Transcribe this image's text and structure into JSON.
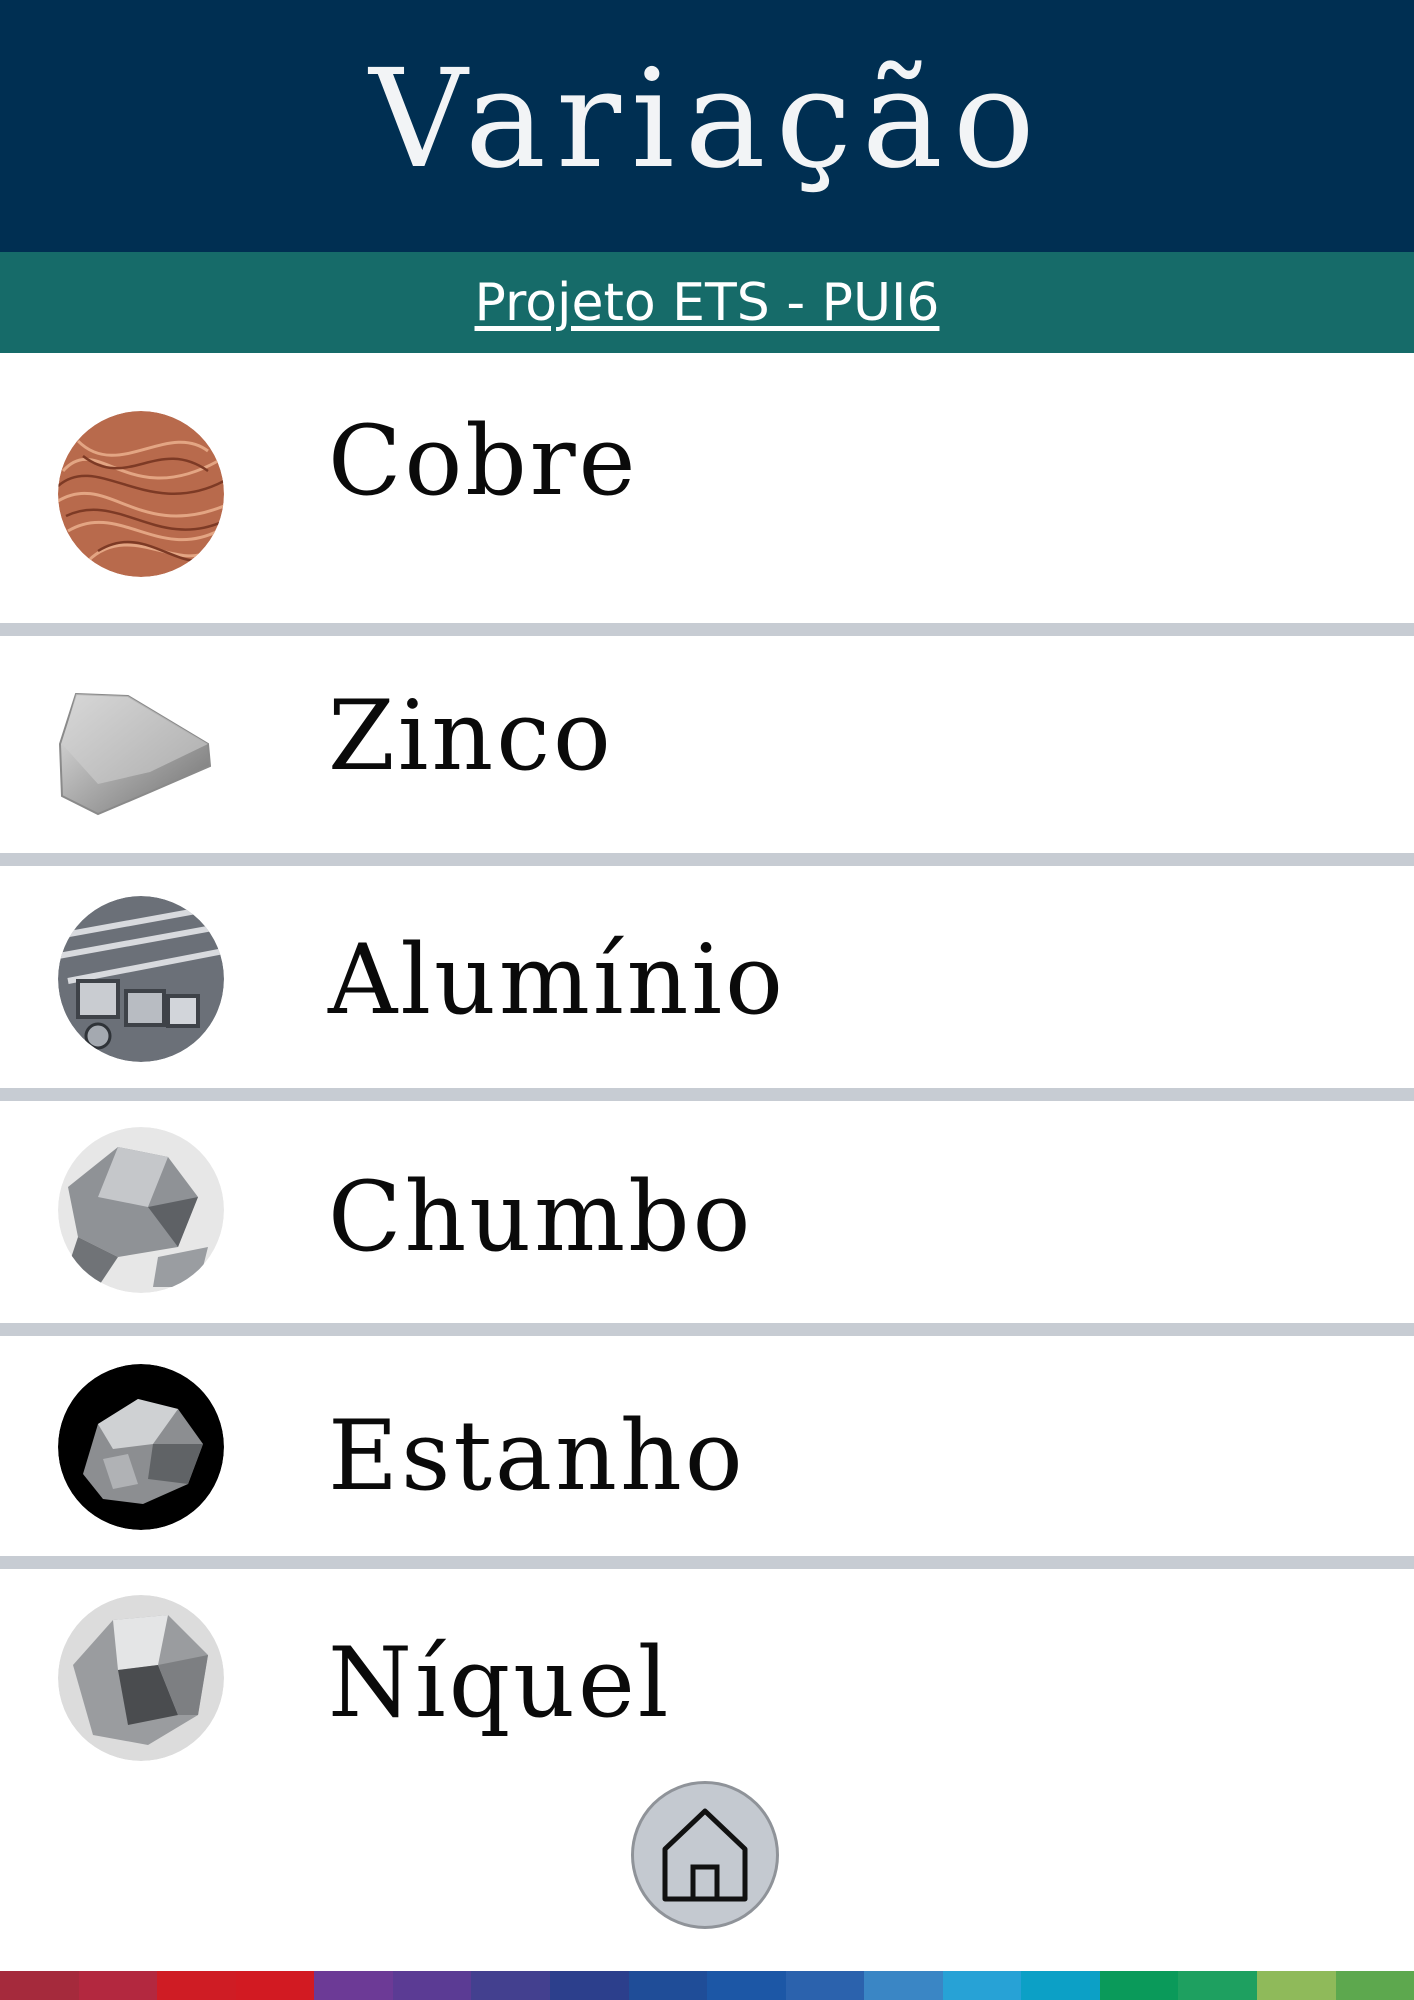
{
  "header": {
    "title": "Variação",
    "subtitle": "Projeto ETS - PUI6"
  },
  "metals": [
    {
      "label": "Cobre",
      "icon": "copper-wire-icon"
    },
    {
      "label": "Zinco",
      "icon": "zinc-ingot-icon"
    },
    {
      "label": "Alumínio",
      "icon": "aluminium-profiles-icon"
    },
    {
      "label": "Chumbo",
      "icon": "lead-rock-icon"
    },
    {
      "label": "Estanho",
      "icon": "tin-nugget-icon"
    },
    {
      "label": "Níquel",
      "icon": "nickel-rock-icon"
    }
  ],
  "home_button": {
    "icon": "home-icon"
  },
  "colors": {
    "header_bg": "#002f52",
    "subbar_bg": "#166b69",
    "separator": "#c7ccd3",
    "home_bg": "#c4c9d0",
    "stripe": [
      "#a52a3c",
      "#b3283f",
      "#cf1c24",
      "#d21a22",
      "#6c3a96",
      "#5b3b94",
      "#43408f",
      "#2c3f8c",
      "#1f4d98",
      "#1c57a6",
      "#2b62ad",
      "#3a86c5",
      "#27a2d6",
      "#0ca0c6",
      "#0a9a5a",
      "#1ea060",
      "#8fba5a",
      "#5da84e"
    ]
  }
}
